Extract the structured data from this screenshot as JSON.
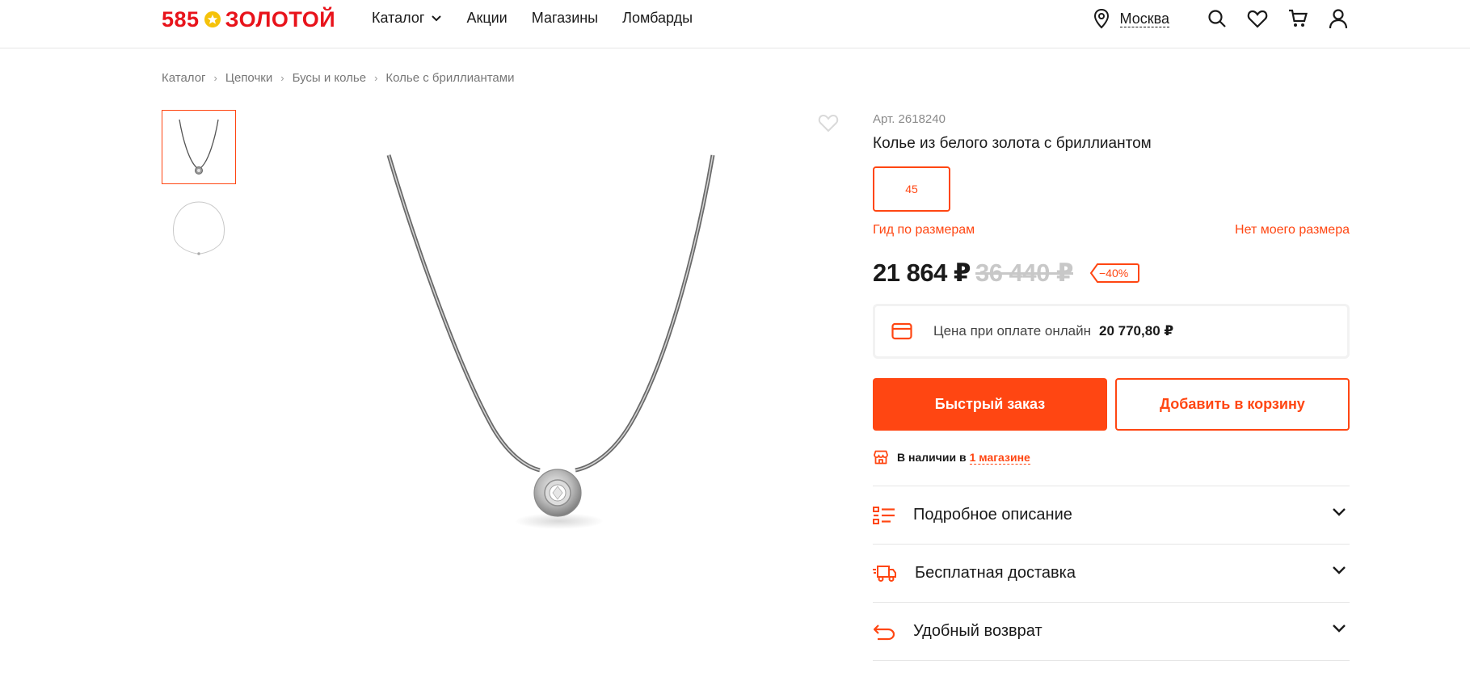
{
  "header": {
    "logo_left": "585",
    "logo_right": "ЗОЛОТОЙ",
    "nav": [
      "Каталог",
      "Акции",
      "Магазины",
      "Ломбарды"
    ],
    "city": "Москва",
    "icons": [
      "location-pin-icon",
      "search-icon",
      "heart-icon",
      "cart-icon",
      "user-icon"
    ]
  },
  "breadcrumb": [
    "Каталог",
    "Цепочки",
    "Бусы и колье",
    "Колье с бриллиантами"
  ],
  "product": {
    "sku": "Арт. 2618240",
    "title": "Колье из белого золота с бриллиантом",
    "sizes": [
      "45"
    ],
    "selected_size": "45",
    "size_guide": "Гид по размерам",
    "no_size": "Нет моего размера",
    "price": "21 864 ₽",
    "old_price": "36 440 ₽",
    "discount": "−40%",
    "online_label": "Цена при оплате онлайн",
    "online_price": "20 770,80 ₽",
    "quick_order": "Быстрый заказ",
    "add_to_cart": "Добавить в корзину",
    "stock_label": "В наличии в",
    "stock_link": "1 магазине"
  },
  "accordion": [
    {
      "label": "Подробное описание",
      "icon": "list-icon"
    },
    {
      "label": "Бесплатная доставка",
      "icon": "truck-icon"
    },
    {
      "label": "Удобный возврат",
      "icon": "return-icon"
    }
  ],
  "colors": {
    "accent": "#ff4612",
    "logo_red": "#e8131b",
    "logo_star": "#f5c20a"
  }
}
